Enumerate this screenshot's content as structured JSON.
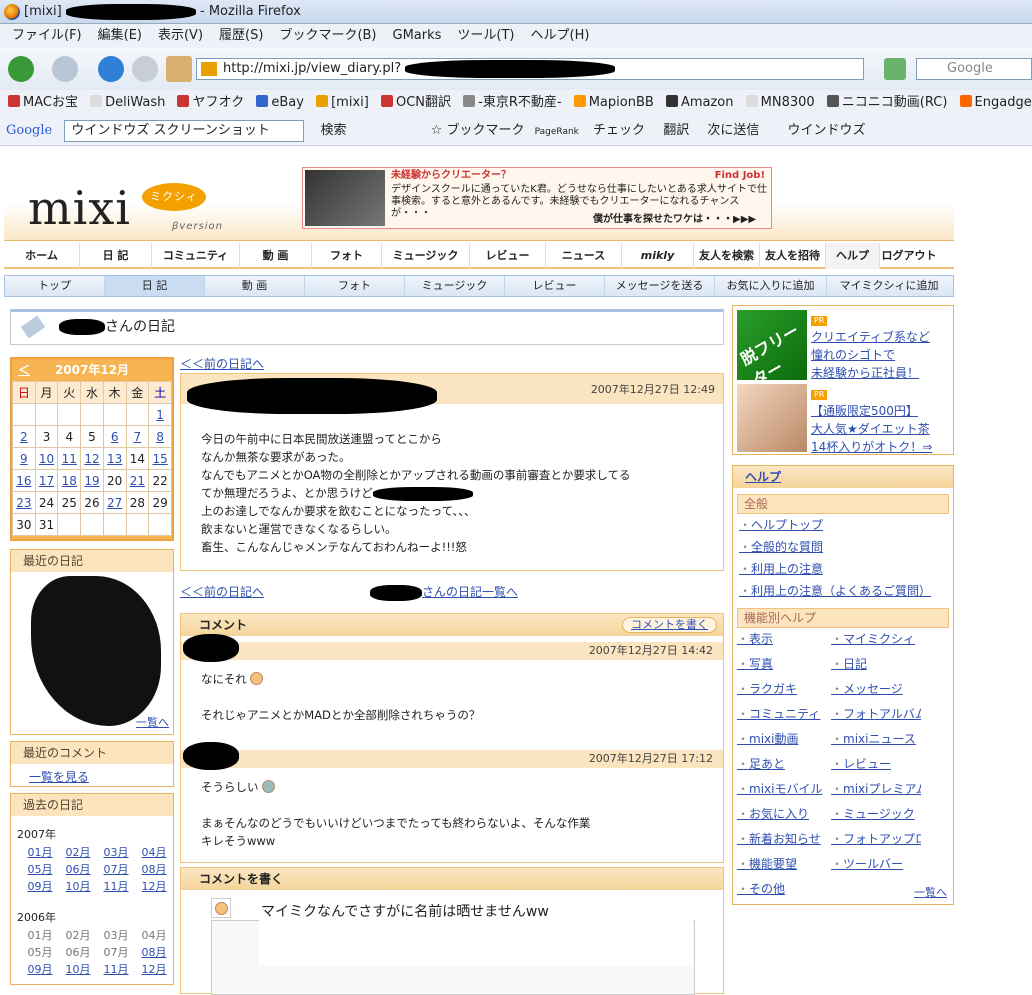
{
  "window": {
    "title_prefix": "[mixi]",
    "title_suffix": "- Mozilla Firefox"
  },
  "menu": [
    "ファイル(F)",
    "編集(E)",
    "表示(V)",
    "履歴(S)",
    "ブックマーク(B)",
    "GMarks",
    "ツール(T)",
    "ヘルプ(H)"
  ],
  "url": "http://mixi.jp/view_diary.pl?",
  "search_placeholder": "Google",
  "bookmarks": [
    "MACお宝",
    "DeliWash",
    "ヤフオク",
    "eBay",
    "[mixi]",
    "OCN翻訳",
    "-東京R不動産-",
    "MapionBB",
    "Amazon",
    "MN8300",
    "ニコニコ動画(RC)",
    "Engadget Japanese"
  ],
  "gtoolbar": {
    "logo": "Google",
    "query": "ウインドウズ スクリーンショット",
    "search": "検索",
    "bookmark": "ブックマーク",
    "pagerank": "PageRank",
    "check": "チェック",
    "translate": "翻訳",
    "send": "次に送信",
    "highlight": "ウインドウズ"
  },
  "header": {
    "logo": "mixi",
    "logo_bubble": "ミクシィ",
    "beta": "βversion",
    "ad": {
      "t1": "未経験からクリエーター？",
      "t2": "デザインスクールに通っていたK君。どうせなら仕事にしたいとある求人サイトで仕事検索。すると意外とあるんです。未経験でもクリエーターになれるチャンスが・・・",
      "t3": "僕が仕事を探せたワケは・・・▶▶▶",
      "fj": "Find Job!"
    }
  },
  "mainnav": [
    "ホーム",
    "日 記",
    "コミュニティ",
    "動 画",
    "フォト",
    "ミュージック",
    "レビュー",
    "ニュース",
    "mikly",
    "友人を検索",
    "友人を招待",
    "ヘルプ",
    "ログアウト"
  ],
  "subnav": [
    "トップ",
    "日 記",
    "動 画",
    "フォト",
    "ミュージック",
    "レビュー",
    "メッセージを送る",
    "お気に入りに追加",
    "マイミクシィに追加"
  ],
  "diary_title": "さんの日記",
  "calendar": {
    "title": "2007年12月",
    "prev": "＜",
    "days": [
      "日",
      "月",
      "火",
      "水",
      "木",
      "金",
      "土"
    ],
    "weeks": [
      [
        "",
        "",
        "",
        "",
        "",
        "",
        "1"
      ],
      [
        "2",
        "3",
        "4",
        "5",
        "6",
        "7",
        "8"
      ],
      [
        "9",
        "10",
        "11",
        "12",
        "13",
        "14",
        "15"
      ],
      [
        "16",
        "17",
        "18",
        "19",
        "20",
        "21",
        "22"
      ],
      [
        "23",
        "24",
        "25",
        "26",
        "27",
        "28",
        "29"
      ],
      [
        "30",
        "31",
        "",
        "",
        "",
        "",
        ""
      ]
    ]
  },
  "recent": {
    "title": "最近の日記",
    "more": "一覧へ"
  },
  "recent_comments": {
    "title": "最近のコメント",
    "link": "一覧を見る"
  },
  "past": {
    "title": "過去の日記",
    "y2007": "2007年",
    "y2006": "2006年",
    "m": [
      [
        "01月",
        "02月",
        "03月",
        "04月"
      ],
      [
        "05月",
        "06月",
        "07月",
        "08月"
      ],
      [
        "09月",
        "10月",
        "11月",
        "12月"
      ]
    ]
  },
  "entry": {
    "prev": "＜＜前の日記へ",
    "date": "2007年12月27日 12:49",
    "lines": [
      "今日の午前中に日本民間放送連盟ってとこから",
      "なんか無茶な要求があった。",
      "なんでもアニメとかOA物の全削除とかアップされる動画の事前審査とか要求してる",
      "てか無理だろうよ、とか思うけど",
      "上のお達しでなんか要求を飲むことになったって、、、",
      "飲まないと運営できなくなるらしい。",
      "畜生、こんなんじゃメンテなんておわんねーよ!!!怒"
    ],
    "list_link": "さんの日記一覧へ"
  },
  "comments": {
    "title": "コメント",
    "write": "コメントを書く",
    "c1": {
      "date": "2007年12月27日 14:42",
      "l1": "なにそれ",
      "l2": "それじゃアニメとかMADとか全部削除されちゃうの？"
    },
    "c2": {
      "date": "2007年12月27日 17:12",
      "l1": "そうらしい",
      "l2": "まぁそんなのどうでもいいけどいつまでたっても終わらないよ、そんな作業",
      "l3": "キレそうwww"
    }
  },
  "write": {
    "title": "コメントを書く",
    "note": "マイミクなんでさすがに名前は晒せませんww"
  },
  "pr": {
    "tag": "PR",
    "img1": "脱フリーター",
    "a1": "クリエイティブ系など",
    "a2": "憧れのシゴトで",
    "a3": "未経験から正社員！",
    "b1": "【通販限定500円】",
    "b2": "大人気★ダイエット茶",
    "b3": "14杯入りがオトク！⇒"
  },
  "help": {
    "title": "ヘルプ",
    "sec1": "全般",
    "general": [
      "ヘルプトップ",
      "全般的な質問",
      "利用上の注意",
      "利用上の注意（よくあるご質問）"
    ],
    "sec2": "機能別ヘルプ",
    "features": [
      "表示",
      "マイミクシィ",
      "写真",
      "日記",
      "ラクガキ",
      "メッセージ",
      "コミュニティ",
      "フォトアルバム",
      "mixi動画",
      "mixiニュース",
      "足あと",
      "レビュー",
      "mixiモバイル",
      "mixiプレミアム",
      "お気に入り",
      "ミュージック",
      "新着お知らせ",
      "フォトアップローダー",
      "機能要望",
      "ツールバー",
      "その他"
    ],
    "more": "一覧へ"
  }
}
